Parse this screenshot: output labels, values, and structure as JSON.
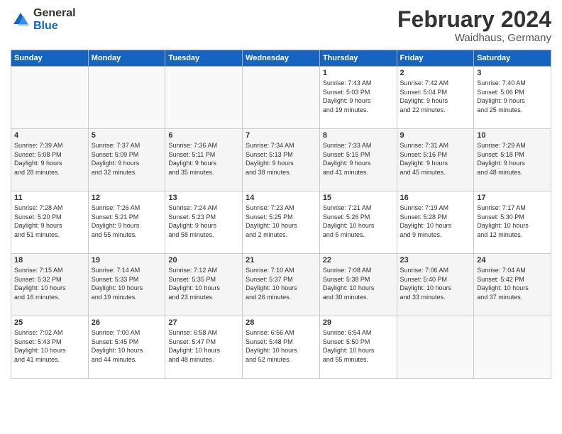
{
  "header": {
    "logo_general": "General",
    "logo_blue": "Blue",
    "month_title": "February 2024",
    "location": "Waidhaus, Germany"
  },
  "weekdays": [
    "Sunday",
    "Monday",
    "Tuesday",
    "Wednesday",
    "Thursday",
    "Friday",
    "Saturday"
  ],
  "weeks": [
    [
      {
        "day": "",
        "info": ""
      },
      {
        "day": "",
        "info": ""
      },
      {
        "day": "",
        "info": ""
      },
      {
        "day": "",
        "info": ""
      },
      {
        "day": "1",
        "info": "Sunrise: 7:43 AM\nSunset: 5:03 PM\nDaylight: 9 hours\nand 19 minutes."
      },
      {
        "day": "2",
        "info": "Sunrise: 7:42 AM\nSunset: 5:04 PM\nDaylight: 9 hours\nand 22 minutes."
      },
      {
        "day": "3",
        "info": "Sunrise: 7:40 AM\nSunset: 5:06 PM\nDaylight: 9 hours\nand 25 minutes."
      }
    ],
    [
      {
        "day": "4",
        "info": "Sunrise: 7:39 AM\nSunset: 5:08 PM\nDaylight: 9 hours\nand 28 minutes."
      },
      {
        "day": "5",
        "info": "Sunrise: 7:37 AM\nSunset: 5:09 PM\nDaylight: 9 hours\nand 32 minutes."
      },
      {
        "day": "6",
        "info": "Sunrise: 7:36 AM\nSunset: 5:11 PM\nDaylight: 9 hours\nand 35 minutes."
      },
      {
        "day": "7",
        "info": "Sunrise: 7:34 AM\nSunset: 5:13 PM\nDaylight: 9 hours\nand 38 minutes."
      },
      {
        "day": "8",
        "info": "Sunrise: 7:33 AM\nSunset: 5:15 PM\nDaylight: 9 hours\nand 41 minutes."
      },
      {
        "day": "9",
        "info": "Sunrise: 7:31 AM\nSunset: 5:16 PM\nDaylight: 9 hours\nand 45 minutes."
      },
      {
        "day": "10",
        "info": "Sunrise: 7:29 AM\nSunset: 5:18 PM\nDaylight: 9 hours\nand 48 minutes."
      }
    ],
    [
      {
        "day": "11",
        "info": "Sunrise: 7:28 AM\nSunset: 5:20 PM\nDaylight: 9 hours\nand 51 minutes."
      },
      {
        "day": "12",
        "info": "Sunrise: 7:26 AM\nSunset: 5:21 PM\nDaylight: 9 hours\nand 55 minutes."
      },
      {
        "day": "13",
        "info": "Sunrise: 7:24 AM\nSunset: 5:23 PM\nDaylight: 9 hours\nand 58 minutes."
      },
      {
        "day": "14",
        "info": "Sunrise: 7:23 AM\nSunset: 5:25 PM\nDaylight: 10 hours\nand 2 minutes."
      },
      {
        "day": "15",
        "info": "Sunrise: 7:21 AM\nSunset: 5:26 PM\nDaylight: 10 hours\nand 5 minutes."
      },
      {
        "day": "16",
        "info": "Sunrise: 7:19 AM\nSunset: 5:28 PM\nDaylight: 10 hours\nand 9 minutes."
      },
      {
        "day": "17",
        "info": "Sunrise: 7:17 AM\nSunset: 5:30 PM\nDaylight: 10 hours\nand 12 minutes."
      }
    ],
    [
      {
        "day": "18",
        "info": "Sunrise: 7:15 AM\nSunset: 5:32 PM\nDaylight: 10 hours\nand 16 minutes."
      },
      {
        "day": "19",
        "info": "Sunrise: 7:14 AM\nSunset: 5:33 PM\nDaylight: 10 hours\nand 19 minutes."
      },
      {
        "day": "20",
        "info": "Sunrise: 7:12 AM\nSunset: 5:35 PM\nDaylight: 10 hours\nand 23 minutes."
      },
      {
        "day": "21",
        "info": "Sunrise: 7:10 AM\nSunset: 5:37 PM\nDaylight: 10 hours\nand 26 minutes."
      },
      {
        "day": "22",
        "info": "Sunrise: 7:08 AM\nSunset: 5:38 PM\nDaylight: 10 hours\nand 30 minutes."
      },
      {
        "day": "23",
        "info": "Sunrise: 7:06 AM\nSunset: 5:40 PM\nDaylight: 10 hours\nand 33 minutes."
      },
      {
        "day": "24",
        "info": "Sunrise: 7:04 AM\nSunset: 5:42 PM\nDaylight: 10 hours\nand 37 minutes."
      }
    ],
    [
      {
        "day": "25",
        "info": "Sunrise: 7:02 AM\nSunset: 5:43 PM\nDaylight: 10 hours\nand 41 minutes."
      },
      {
        "day": "26",
        "info": "Sunrise: 7:00 AM\nSunset: 5:45 PM\nDaylight: 10 hours\nand 44 minutes."
      },
      {
        "day": "27",
        "info": "Sunrise: 6:58 AM\nSunset: 5:47 PM\nDaylight: 10 hours\nand 48 minutes."
      },
      {
        "day": "28",
        "info": "Sunrise: 6:56 AM\nSunset: 5:48 PM\nDaylight: 10 hours\nand 52 minutes."
      },
      {
        "day": "29",
        "info": "Sunrise: 6:54 AM\nSunset: 5:50 PM\nDaylight: 10 hours\nand 55 minutes."
      },
      {
        "day": "",
        "info": ""
      },
      {
        "day": "",
        "info": ""
      }
    ]
  ]
}
